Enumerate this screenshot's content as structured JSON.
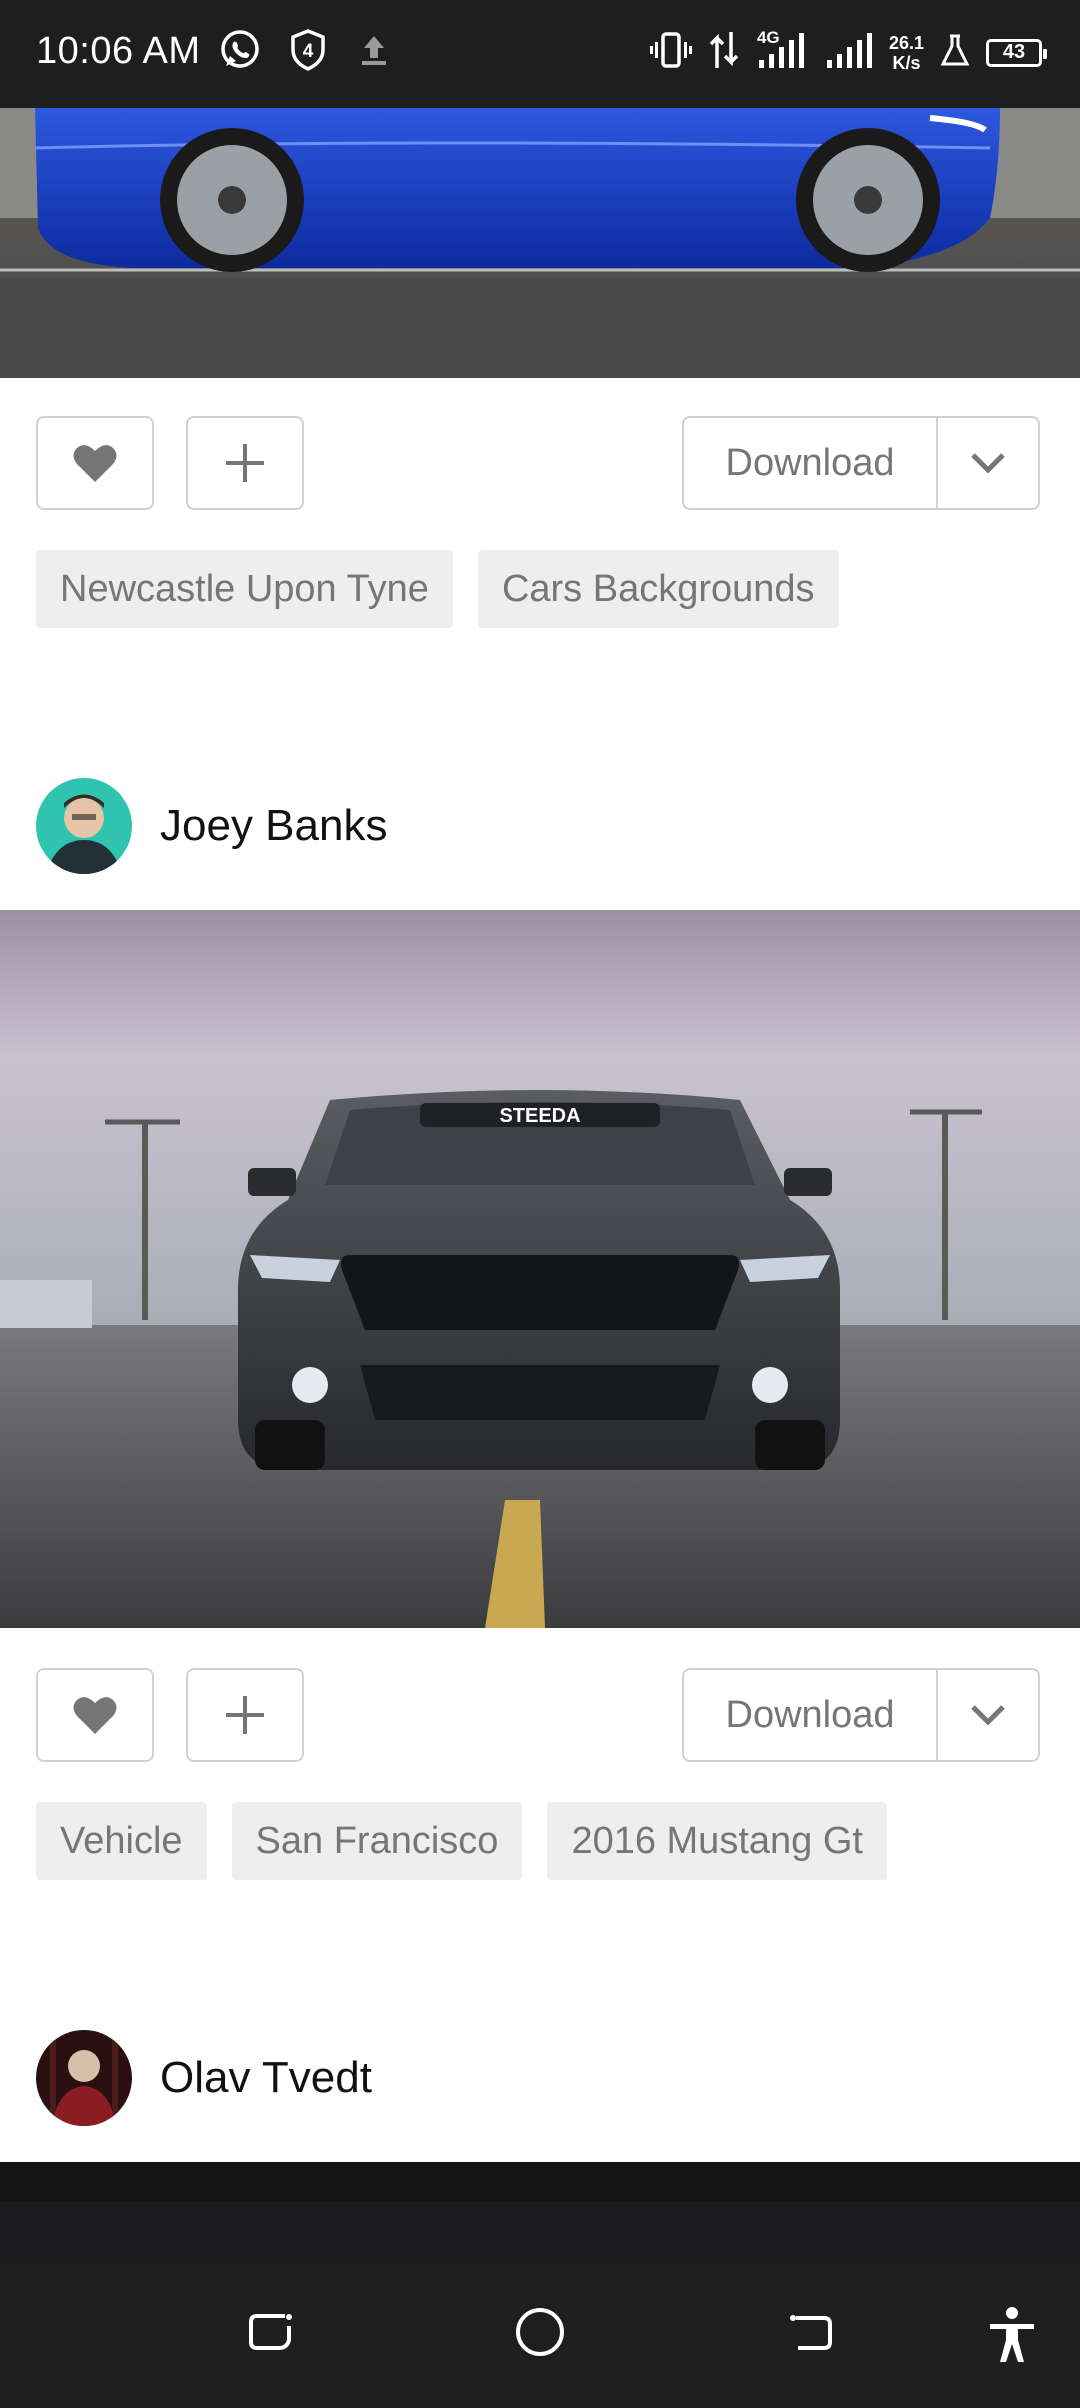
{
  "status_bar": {
    "time": "10:06 AM",
    "network": "4G",
    "speed_value": "26.1",
    "speed_unit": "K/s",
    "battery": "43",
    "icons": [
      "whatsapp-icon",
      "shield-4-icon",
      "upload-icon",
      "vibrate-icon",
      "data-arrows-icon",
      "signal-icon",
      "signal-icon",
      "lab-icon",
      "battery-icon"
    ]
  },
  "posts": [
    {
      "user": null,
      "photo": "blue-car-photo",
      "download_label": "Download",
      "tags": [
        "Newcastle Upon Tyne",
        "Cars Backgrounds"
      ]
    },
    {
      "user": "Joey Banks",
      "photo": "grey-mustang-photo",
      "plate_text": "STEEDA",
      "download_label": "Download",
      "tags": [
        "Vehicle",
        "San Francisco",
        "2016 Mustang Gt"
      ]
    },
    {
      "user": "Olav Tvedt",
      "photo": "dark-night-photo"
    }
  ],
  "nav_bar": {
    "icons": [
      "recents-icon",
      "home-icon",
      "back-icon",
      "accessibility-icon"
    ]
  },
  "colors": {
    "status_bar_bg": "#1e1e1e",
    "border": "#d1d1d1",
    "tag_bg": "#eeeeee",
    "muted_text": "#767676"
  }
}
